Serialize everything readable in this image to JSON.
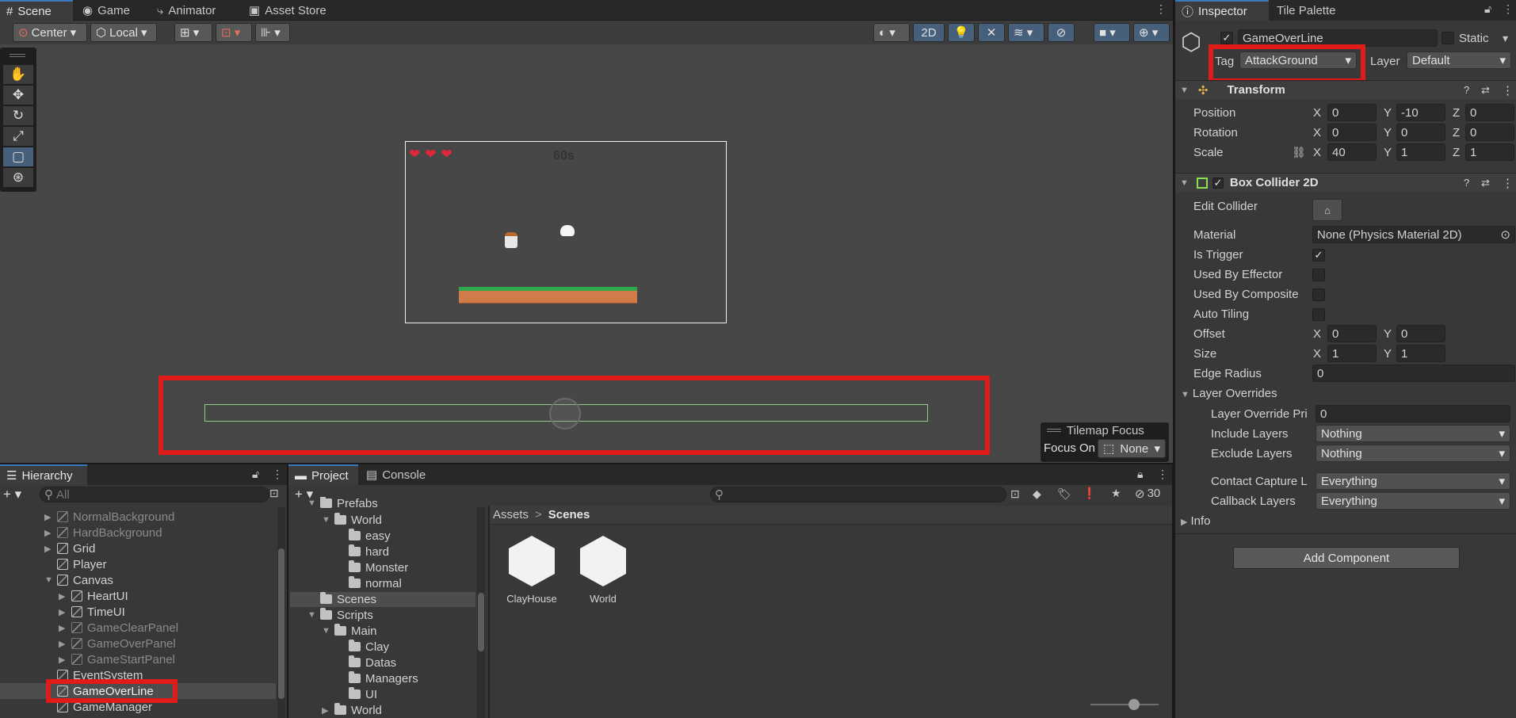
{
  "scene_view": {
    "tabs": [
      {
        "label": "Scene",
        "icon": "grid-icon"
      },
      {
        "label": "Game",
        "icon": "gamepad-icon"
      },
      {
        "label": "Animator",
        "icon": "animator-icon"
      },
      {
        "label": "Asset Store",
        "icon": "bag-icon"
      }
    ],
    "toolbar": {
      "pivot": "Center",
      "space": "Local",
      "mode_2d": "2D"
    },
    "game_hud": {
      "timer": "60s"
    },
    "tilemap_focus": {
      "title": "Tilemap Focus",
      "focus_label": "Focus On",
      "focus_value": "None"
    }
  },
  "hierarchy": {
    "title": "Hierarchy",
    "search_placeholder": "All",
    "items": [
      {
        "label": "NormalBackground",
        "dim": true
      },
      {
        "label": "HardBackground",
        "dim": true
      },
      {
        "label": "Grid",
        "dim": false
      },
      {
        "label": "Player",
        "dim": false
      },
      {
        "label": "Canvas",
        "dim": false
      },
      {
        "label": "HeartUI",
        "dim": false
      },
      {
        "label": "TimeUI",
        "dim": false
      },
      {
        "label": "GameClearPanel",
        "dim": true
      },
      {
        "label": "GameOverPanel",
        "dim": true
      },
      {
        "label": "GameStartPanel",
        "dim": true
      },
      {
        "label": "EventSystem",
        "dim": false
      },
      {
        "label": "GameOverLine",
        "dim": false
      },
      {
        "label": "GameManager",
        "dim": false
      }
    ]
  },
  "project": {
    "tabs": [
      "Project",
      "Console"
    ],
    "hidden_count": "30",
    "tree": [
      {
        "label": "Prefabs"
      },
      {
        "label": "World"
      },
      {
        "label": "easy"
      },
      {
        "label": "hard"
      },
      {
        "label": "Monster"
      },
      {
        "label": "normal"
      },
      {
        "label": "Scenes"
      },
      {
        "label": "Scripts"
      },
      {
        "label": "Main"
      },
      {
        "label": "Clay"
      },
      {
        "label": "Datas"
      },
      {
        "label": "Managers"
      },
      {
        "label": "UI"
      },
      {
        "label": "World"
      }
    ],
    "breadcrumb": {
      "root": "Assets",
      "separator": ">",
      "current": "Scenes"
    },
    "assets": [
      {
        "label": "ClayHouse"
      },
      {
        "label": "World"
      }
    ]
  },
  "inspector": {
    "tabs": [
      "Inspector",
      "Tile Palette"
    ],
    "object_name": "GameOverLine",
    "static_label": "Static",
    "tag_label": "Tag",
    "tag_value": "AttackGround",
    "layer_label": "Layer",
    "layer_value": "Default",
    "transform": {
      "title": "Transform",
      "position_label": "Position",
      "rotation_label": "Rotation",
      "scale_label": "Scale",
      "position": {
        "x": "0",
        "y": "-10",
        "z": "0"
      },
      "rotation": {
        "x": "0",
        "y": "0",
        "z": "0"
      },
      "scale": {
        "x": "40",
        "y": "1",
        "z": "1"
      }
    },
    "box_collider": {
      "title": "Box Collider 2D",
      "edit_collider": "Edit Collider",
      "material_label": "Material",
      "material_value": "None (Physics Material 2D)",
      "is_trigger": "Is Trigger",
      "used_by_effector": "Used By Effector",
      "used_by_composite": "Used By Composite",
      "auto_tiling": "Auto Tiling",
      "offset_label": "Offset",
      "offset": {
        "x": "0",
        "y": "0"
      },
      "size_label": "Size",
      "size": {
        "x": "1",
        "y": "1"
      },
      "edge_radius_label": "Edge Radius",
      "edge_radius": "0",
      "layer_overrides": "Layer Overrides",
      "layer_override_priority_label": "Layer Override Pri",
      "layer_override_priority": "0",
      "include_layers_label": "Include Layers",
      "include_layers": "Nothing",
      "exclude_layers_label": "Exclude Layers",
      "exclude_layers": "Nothing",
      "contact_capture_label": "Contact Capture L",
      "contact_capture": "Everything",
      "callback_layers_label": "Callback Layers",
      "callback_layers": "Everything"
    },
    "info_label": "Info",
    "add_component": "Add Component"
  },
  "axis": {
    "x": "X",
    "y": "Y",
    "z": "Z"
  },
  "colors": {
    "highlight_red": "#e11a1a",
    "selection_blue": "#46607c",
    "scene_bg": "#474747"
  }
}
